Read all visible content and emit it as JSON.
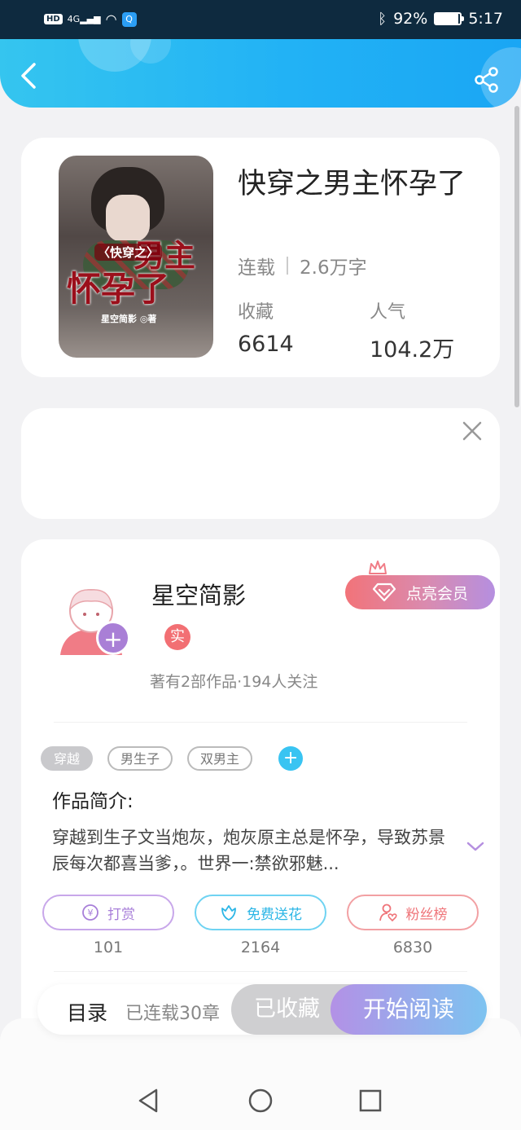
{
  "status_bar": {
    "hd": "HD",
    "signal": "4G",
    "search_icon_glyph": "Q",
    "battery": "92%",
    "battery_level": 0.92,
    "time": "5:17"
  },
  "book": {
    "title": "快穿之男主怀孕了",
    "cover_text_small": "〈快穿之〉",
    "cover_text_main1": "男主",
    "cover_text_main2": "怀孕了",
    "cover_author": "星空简影 ◎著",
    "status": "连载",
    "word_count": "2.6万字",
    "favorites_label": "收藏",
    "favorites_value": "6614",
    "popularity_label": "人气",
    "popularity_value": "104.2万"
  },
  "author": {
    "name": "星空简影",
    "follow_plus": "+",
    "real_badge": "实",
    "meta": "著有2部作品·194人关注",
    "vip_button": "点亮会员"
  },
  "tags": [
    {
      "label": "穿越"
    },
    {
      "label": "男生子"
    },
    {
      "label": "双男主"
    }
  ],
  "tag_add": "+",
  "intro": {
    "title": "作品简介:",
    "text": "穿越到生子文当炮灰，炮灰原主总是怀孕，导致苏景辰每次都喜当爹，。世界一:禁欲邪魅..."
  },
  "actions": {
    "reward": {
      "label": "打赏",
      "count": "101"
    },
    "flower": {
      "label": "免费送花",
      "count": "2164"
    },
    "fans": {
      "label": "粉丝榜",
      "count": "6830"
    }
  },
  "bottom": {
    "toc": "目录",
    "chapters": "已连载30章",
    "collected": "已收藏",
    "start_read": "开始阅读"
  },
  "colors": {
    "header_blue": "#22b2f5",
    "reward_purple": "#b58fe0",
    "flower_cyan": "#39c4f2",
    "fans_red": "#f27379"
  }
}
